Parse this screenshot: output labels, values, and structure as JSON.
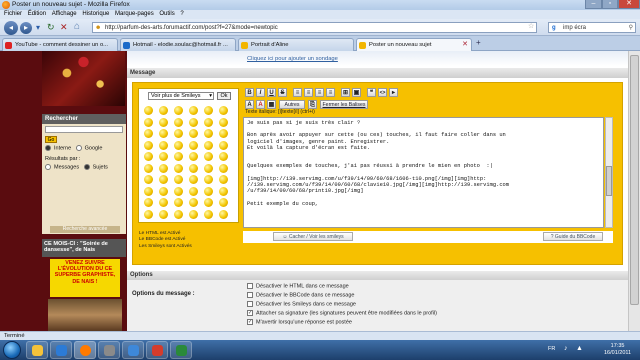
{
  "window": {
    "title": "Poster un nouveau sujet - Mozilla Firefox"
  },
  "menu": [
    "Fichier",
    "Édition",
    "Affichage",
    "Historique",
    "Marque-pages",
    "Outils",
    "?"
  ],
  "nav": {
    "url": "http://parfum-des-arts.forumactif.com/post?f=27&mode=newtopic",
    "search_value": "imp écra"
  },
  "tabs": [
    {
      "label": "YouTube - comment dessiner un o...",
      "color": "#d22"
    },
    {
      "label": "Hotmail - elodie.soulac@hotmail.fr ...",
      "color": "#1b6ac9"
    },
    {
      "label": "Portrait d'Aline",
      "color": "#f2b500"
    },
    {
      "label": "Poster un nouveau sujet",
      "color": "#f2b500"
    }
  ],
  "sidebar": {
    "search_title": "Rechercher",
    "go_label": "Go",
    "scope": [
      "Interne",
      "Google"
    ],
    "results_label": "Résultats par :",
    "results_options": [
      "Messages",
      "Sujets"
    ],
    "advanced_label": "Recherche avancée",
    "ccmois_title": "CE MOIS-CI : \"Soirée de dansesse\", de Nais",
    "promo_text": "VENEZ SUIVRE L'ÉVOLUTION DU CE SUPERBE GRAPHISTE, DE NAIS !"
  },
  "main": {
    "poll_link": "Cliquez ici pour ajouter un sondage",
    "message_header": "Message",
    "smileys_select": "Voir plus de Smileys",
    "ok_label": "Ok",
    "html_info": [
      "Le HTML est Activé",
      "Le BBCode est Activé",
      "Les Smileys sont Activés"
    ],
    "toolbar_buttons": [
      "B",
      "I",
      "U",
      "S",
      "≡",
      "≡",
      "≡",
      "≡",
      "⊞",
      "▣",
      "❝",
      "<>",
      "▸"
    ],
    "toolbar_text_buttons": [
      "Autres",
      "Fermer les Balises"
    ],
    "toolbar_hint": "Texte italique: [i]texte[/i] (ctrl+i)",
    "textarea_lines": [
      "Je suis pas si je suis très clair ?",
      "",
      "Bon après avoir appuyer sur cette (ou ces) touches, il faut faire coller dans un",
      "logiciel d'images, genre paint. Enregistrer.",
      "Et voilà la capture d'écran est faite.",
      "",
      "",
      "Quelques exemples de touches, j'ai pas réussi à prendre le mien en photo  :|",
      "",
      "[img]http://i39.servimg.com/u/f39/14/09/60/68/1606-t10.png[/img][img]http:",
      "//i39.servimg.com/u/f39/14/09/60/68/clavie10.jpg[/img][img]http://i39.servimg.com",
      "/u/f39/14/09/60/68/print10.jpg[/img]",
      "",
      "Petit exemple du coup,"
    ],
    "hide_smileys": "Cacher / Voir les smileys",
    "bbcode_guide": "Guide du BBCode",
    "options_header": "Options",
    "options_label": "Options du message :",
    "options": [
      {
        "label": "Désactiver le HTML dans ce message",
        "checked": false
      },
      {
        "label": "Désactiver le BBCode dans ce message",
        "checked": false
      },
      {
        "label": "Désactiver les Smileys dans ce message",
        "checked": false
      },
      {
        "label": "Attacher sa signature (les signatures peuvent être modifiées dans le profil)",
        "checked": true
      },
      {
        "label": "M'avertir lorsqu'une réponse est postée",
        "checked": true
      }
    ]
  },
  "status": {
    "text": "Terminé"
  },
  "taskbar": {
    "apps": [
      "#f5c23a",
      "#2c7bd6",
      "#ff7a00",
      "#8a8a8a",
      "#3e88d9",
      "#d43c2c",
      "#2a8a3a"
    ],
    "lang": "FR",
    "time": "17:35",
    "date": "16/01/2011"
  }
}
